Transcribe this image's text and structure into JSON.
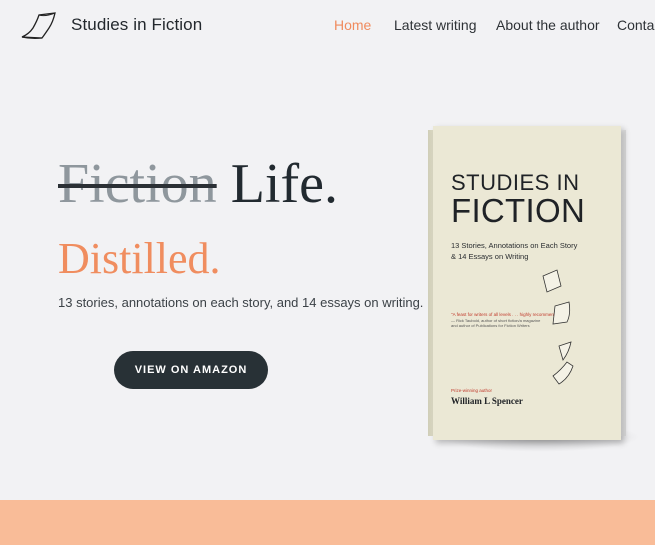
{
  "header": {
    "brand": "Studies in Fiction",
    "nav": [
      {
        "label": "Home",
        "active": true
      },
      {
        "label": "Latest writing",
        "active": false
      },
      {
        "label": "About the author",
        "active": false
      },
      {
        "label": "Contact",
        "active": false
      }
    ]
  },
  "hero": {
    "struck_word": "Fiction",
    "word": "Life.",
    "subtitle": "Distilled.",
    "tagline": "13 stories, annotations on each story, and 14 essays on writing.",
    "cta_label": "VIEW ON AMAZON"
  },
  "book": {
    "title_line1": "STUDIES IN",
    "title_line2": "FICTION",
    "subtitle_line1": "13 Stories, Annotations on Each Story",
    "subtitle_line2": "& 14 Essays on Writing",
    "quote": "\"A feast for writers of all levels . . . highly recommended!\"",
    "quote_attr1": "— Rick Taubold, author of short fiction/a magazine",
    "quote_attr2": "and author of Publications for Fiction Writers",
    "award": "Prize-winning author",
    "author": "William L Spencer"
  },
  "colors": {
    "accent": "#f08b5e",
    "background": "#f2f2f4",
    "button": "#283136",
    "footer_band": "#f9bc98"
  },
  "icons": {
    "logo": "paper-page-icon"
  }
}
